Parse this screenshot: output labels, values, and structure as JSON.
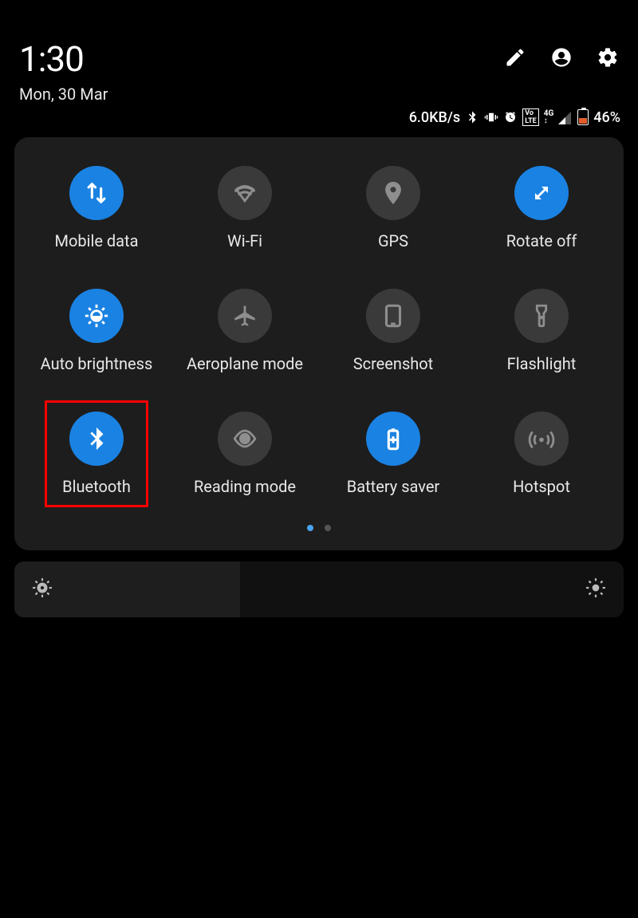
{
  "status": {
    "time": "1:30",
    "date": "Mon, 30 Mar",
    "speed": "6.0KB/s",
    "net_badge": "Vo LTE",
    "net_gen": "4G",
    "battery_pct": "46%"
  },
  "tiles": [
    {
      "key": "mobile-data",
      "label": "Mobile data",
      "on": true
    },
    {
      "key": "wifi",
      "label": "Wi-Fi",
      "on": false
    },
    {
      "key": "gps",
      "label": "GPS",
      "on": false
    },
    {
      "key": "rotate",
      "label": "Rotate off",
      "on": true
    },
    {
      "key": "auto-brightness",
      "label": "Auto brightness",
      "on": true
    },
    {
      "key": "aeroplane",
      "label": "Aeroplane mode",
      "on": false
    },
    {
      "key": "screenshot",
      "label": "Screenshot",
      "on": false
    },
    {
      "key": "flashlight",
      "label": "Flashlight",
      "on": false
    },
    {
      "key": "bluetooth",
      "label": "Bluetooth",
      "on": true
    },
    {
      "key": "reading-mode",
      "label": "Reading mode",
      "on": false
    },
    {
      "key": "battery-saver",
      "label": "Battery saver",
      "on": true
    },
    {
      "key": "hotspot",
      "label": "Hotspot",
      "on": false
    }
  ],
  "highlighted_tile": "bluetooth",
  "pages": {
    "total": 2,
    "active": 0
  },
  "brightness": {
    "level_pct": 37
  }
}
